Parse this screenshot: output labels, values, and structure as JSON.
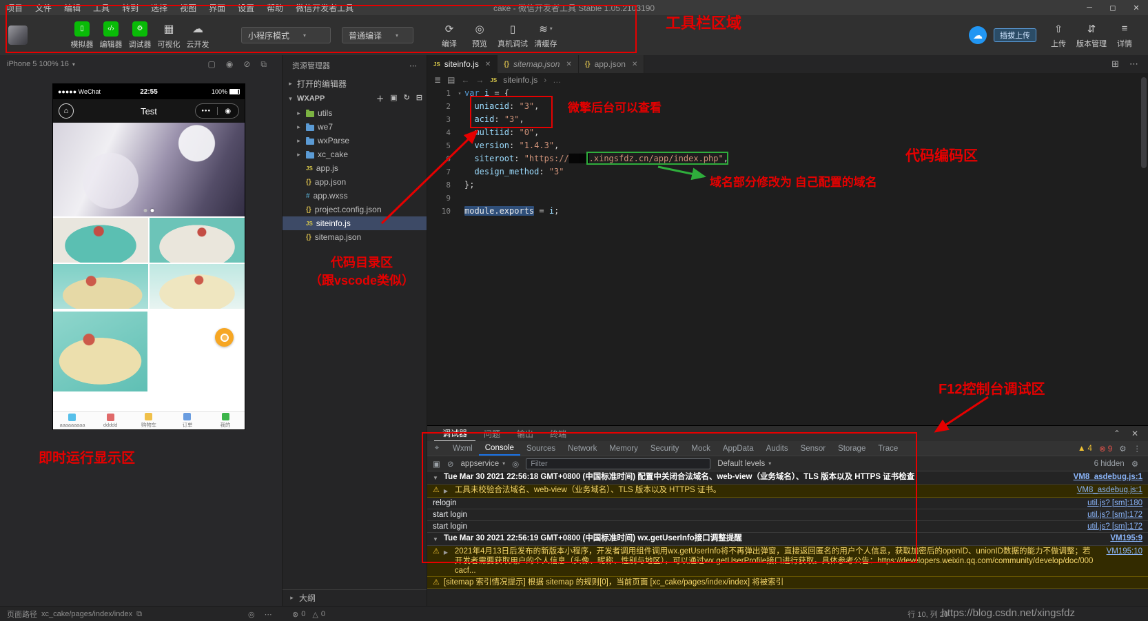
{
  "window": {
    "title": "cake - 微信开发者工具 Stable 1.05.2103190",
    "menu": [
      "项目",
      "文件",
      "编辑",
      "工具",
      "转到",
      "选择",
      "视图",
      "界面",
      "设置",
      "帮助",
      "微信开发者工具"
    ],
    "controls": {
      "minimize": "─",
      "maximize": "◻",
      "close": "✕"
    }
  },
  "toolbar": {
    "toggles": [
      {
        "id": "simulator",
        "label": "模拟器",
        "glyph": "▯",
        "green": true
      },
      {
        "id": "editor",
        "label": "编辑器",
        "glyph": "‹/›",
        "green": true
      },
      {
        "id": "debugger",
        "label": "调试器",
        "glyph": "⚙",
        "green": true
      },
      {
        "id": "visualizer",
        "label": "可视化",
        "glyph": "▦",
        "green": false
      },
      {
        "id": "cloud-dev",
        "label": "云开发",
        "glyph": "☁",
        "green": false
      }
    ],
    "mode_select": "小程序模式",
    "compile_select": "普通编译",
    "actions": [
      {
        "id": "compile",
        "label": "编译",
        "glyph": "⟳"
      },
      {
        "id": "preview",
        "label": "预览",
        "glyph": "◎"
      },
      {
        "id": "device-debug",
        "label": "真机调试",
        "glyph": "▯"
      },
      {
        "id": "clear-cache",
        "label": "清缓存",
        "glyph": "≋",
        "caret": "▾"
      }
    ],
    "upload_badge": "插拔上传",
    "right_buttons": [
      {
        "id": "upload",
        "label": "上传",
        "glyph": "⇧"
      },
      {
        "id": "version",
        "label": "版本管理",
        "glyph": "⇵"
      },
      {
        "id": "detail",
        "label": "详情",
        "glyph": "≡"
      }
    ]
  },
  "simulator": {
    "device_label": "iPhone 5 100% 16",
    "phone": {
      "carrier": "●●●●● WeChat",
      "time": "22:55",
      "battery": "100%",
      "nav_title": "Test",
      "capsule_dots": "●●●",
      "capsule_circle": "◉",
      "tabbar": [
        {
          "label": "aaaaaaaaa",
          "color": "#57c0ea"
        },
        {
          "label": "ddddd",
          "color": "#e06a6a"
        },
        {
          "label": "购物车",
          "color": "#f0c04a"
        },
        {
          "label": "订单",
          "color": "#6a9de0"
        },
        {
          "label": "我的",
          "color": "#3cb54a"
        }
      ]
    }
  },
  "explorer": {
    "title": "资源管理器",
    "open_editors": "打开的编辑器",
    "project": "WXAPP",
    "files": [
      {
        "name": "utils",
        "type": "folder",
        "color": "#7cb342"
      },
      {
        "name": "we7",
        "type": "folder",
        "color": "#5b9bd5"
      },
      {
        "name": "wxParse",
        "type": "folder",
        "color": "#5b9bd5"
      },
      {
        "name": "xc_cake",
        "type": "folder",
        "color": "#5b9bd5"
      },
      {
        "name": "app.js",
        "type": "js"
      },
      {
        "name": "app.json",
        "type": "json"
      },
      {
        "name": "app.wxss",
        "type": "wxss"
      },
      {
        "name": "project.config.json",
        "type": "json"
      },
      {
        "name": "siteinfo.js",
        "type": "js",
        "selected": true
      },
      {
        "name": "sitemap.json",
        "type": "json"
      }
    ],
    "outline": "大纲"
  },
  "editor": {
    "tabs": [
      {
        "name": "siteinfo.js",
        "icon": "js",
        "active": true
      },
      {
        "name": "sitemap.json",
        "icon": "json",
        "italic": true
      },
      {
        "name": "app.json",
        "icon": "json"
      }
    ],
    "breadcrumb": {
      "file": "siteinfo.js",
      "more": "…"
    },
    "lines": [
      {
        "num": "1",
        "fold": "▾",
        "tokens": [
          [
            "kw",
            "var"
          ],
          [
            "pl",
            " "
          ],
          [
            "id",
            "i"
          ],
          [
            "pl",
            " = {"
          ]
        ]
      },
      {
        "num": "2",
        "tokens": [
          [
            "pl",
            "  "
          ],
          [
            "prop",
            "uniacid"
          ],
          [
            "pl",
            ": "
          ],
          [
            "str",
            "\"3\""
          ],
          [
            "pl",
            ","
          ]
        ]
      },
      {
        "num": "3",
        "tokens": [
          [
            "pl",
            "  "
          ],
          [
            "prop",
            "acid"
          ],
          [
            "pl",
            ": "
          ],
          [
            "str",
            "\"3\""
          ],
          [
            "pl",
            ","
          ]
        ]
      },
      {
        "num": "4",
        "tokens": [
          [
            "pl",
            "  "
          ],
          [
            "prop",
            "multiid"
          ],
          [
            "pl",
            ": "
          ],
          [
            "str",
            "\"0\""
          ],
          [
            "pl",
            ","
          ]
        ]
      },
      {
        "num": "5",
        "tokens": [
          [
            "pl",
            "  "
          ],
          [
            "prop",
            "version"
          ],
          [
            "pl",
            ": "
          ],
          [
            "str",
            "\"1.4.3\""
          ],
          [
            "pl",
            ","
          ]
        ]
      },
      {
        "num": "6",
        "tokens": [
          [
            "pl",
            "  "
          ],
          [
            "prop",
            "siteroot"
          ],
          [
            "pl",
            ": "
          ],
          [
            "str",
            "\"https://"
          ],
          [
            "red",
            "████"
          ],
          [
            "str",
            ".xingsfdz.cn/app/index.php\""
          ],
          [
            "pl",
            ","
          ]
        ]
      },
      {
        "num": "7",
        "tokens": [
          [
            "pl",
            "  "
          ],
          [
            "prop",
            "design_method"
          ],
          [
            "pl",
            ": "
          ],
          [
            "str",
            "\"3\""
          ]
        ]
      },
      {
        "num": "8",
        "tokens": [
          [
            "pl",
            "};"
          ]
        ]
      },
      {
        "num": "9",
        "tokens": []
      },
      {
        "num": "10",
        "tokens": [
          [
            "sel",
            "module.exports"
          ],
          [
            "pl",
            " = "
          ],
          [
            "id",
            "i"
          ],
          [
            "pl",
            ";"
          ]
        ]
      }
    ]
  },
  "console": {
    "panel_tabs": [
      "调试器",
      "问题",
      "输出",
      "终端"
    ],
    "active_panel_tab": "调试器",
    "devtools_tabs": [
      "Wxml",
      "Console",
      "Sources",
      "Network",
      "Memory",
      "Security",
      "Mock",
      "AppData",
      "Audits",
      "Sensor",
      "Storage",
      "Trace"
    ],
    "active_devtools_tab": "Console",
    "warn_count": "4",
    "error_count": "9",
    "context": "appservice",
    "filter_placeholder": "Filter",
    "levels_label": "Default levels",
    "hidden_label": "6 hidden",
    "messages": [
      {
        "type": "group",
        "caret": "▼",
        "text": "Tue Mar 30 2021 22:56:18 GMT+0800 (中国标准时间) 配置中关闭合法域名、web-view（业务域名）、TLS 版本以及 HTTPS 证书检查",
        "link": "VM8_asdebug.js:1"
      },
      {
        "type": "warn",
        "caret": "▶",
        "text": "工具未校验合法域名、web-view（业务域名）、TLS 版本以及 HTTPS 证书。",
        "link": "VM8_asdebug.js:1"
      },
      {
        "type": "log",
        "text": "relogin",
        "link": "util.js? [sm]:180"
      },
      {
        "type": "log",
        "text": "start login",
        "link": "util.js? [sm]:172"
      },
      {
        "type": "log",
        "text": "start login",
        "link": "util.js? [sm]:172"
      },
      {
        "type": "group",
        "caret": "▼",
        "text": "Tue Mar 30 2021 22:56:19 GMT+0800 (中国标准时间) wx.getUserInfo接口调整提醒",
        "link": "VM195:9"
      },
      {
        "type": "warn",
        "caret": "▶",
        "text": "2021年4月13日后发布的新版本小程序，开发者调用组件调用wx.getUserInfo将不再弹出弹窗，直接返回匿名的用户个人信息，获取加密后的openID、unionID数据的能力不做调整；若开发者需要获取用户的个人信息（头像、昵称、性别与地区），可以通过wx.getUserProfile接口进行获取。具体参考公告：https://developers.weixin.qq.com/community/develop/doc/000cacf...",
        "link": "VM195:10"
      },
      {
        "type": "warn",
        "text": "[sitemap 索引情况提示] 根据 sitemap 的规则[0]，当前页面 [xc_cake/pages/index/index] 将被索引",
        "link": ""
      }
    ]
  },
  "statusbar": {
    "path_label": "页面路径",
    "page_path": "xc_cake/pages/index/index",
    "error_count": "0",
    "warning_count": "0",
    "cursor": "行 10, 列 20"
  },
  "annotations": {
    "toolbar_area": "工具栏区域",
    "backend_view": "微擎后台可以查看",
    "code_area": "代码编码区",
    "domain_note": "域名部分修改为 自己配置的域名",
    "tree_line1": "代码目录区",
    "tree_line2": "（跟vscode类似）",
    "runtime_area": "即时运行显示区",
    "console_area": "F12控制台调试区"
  },
  "watermark": "https://blog.csdn.net/xingsfdz"
}
